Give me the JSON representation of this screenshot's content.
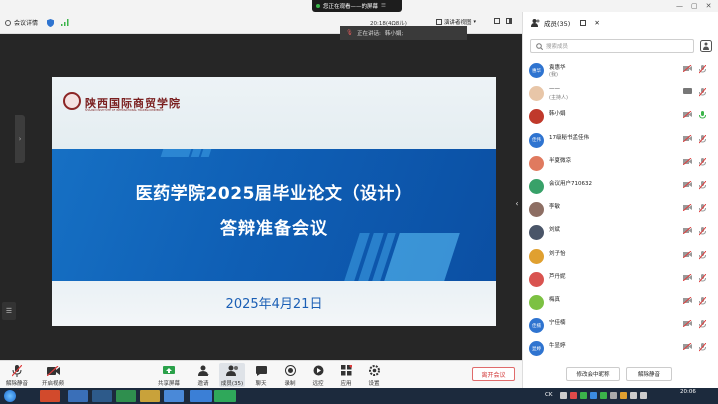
{
  "titlebar": {
    "share_banner": "您正在观看——的屏幕",
    "panel_title": "成员(35)"
  },
  "infobar": {
    "meeting_detail": "会议详情",
    "clock_text": "20:18(4Ω8ル)",
    "view_text": "演讲者视图"
  },
  "speaking": {
    "label": "正在讲话:",
    "name": "韩小娟;"
  },
  "slide": {
    "school_name": "陕西国际商贸学院",
    "school_en": "SHAANXI INSTITUTE OF INTERNATIONAL TRADE&COMMERCE",
    "title_line1": "医药学院2025届毕业论文（设计）",
    "title_line2": "答辩准备会议",
    "date": "2025年4月21日"
  },
  "toolbar": {
    "items": [
      {
        "label": "解除静音",
        "icon": "mic-muted-icon"
      },
      {
        "label": "开启视频",
        "icon": "camera-off-icon"
      },
      {
        "label": "共享屏幕",
        "icon": "share-screen-icon"
      },
      {
        "label": "邀请",
        "icon": "invite-icon"
      },
      {
        "label": "成员(35)",
        "icon": "members-icon"
      },
      {
        "label": "聊天",
        "icon": "chat-icon"
      },
      {
        "label": "录制",
        "icon": "record-icon"
      },
      {
        "label": "远控",
        "icon": "remote-control-icon"
      },
      {
        "label": "应用",
        "icon": "apps-icon"
      },
      {
        "label": "设置",
        "icon": "settings-icon"
      }
    ],
    "leave_label": "离开会议"
  },
  "panel": {
    "search_placeholder": "搜索成员",
    "members": [
      {
        "avatar_text": "惠华",
        "name": "袁惠华",
        "sub": "(我)",
        "color": "#2f74d0"
      },
      {
        "avatar_text": "",
        "name": "——",
        "sub": "(主持人)",
        "color": "#e8c6a8"
      },
      {
        "avatar_text": "",
        "name": "韩小娟",
        "sub": "",
        "color": "#c0392b"
      },
      {
        "avatar_text": "佳伟",
        "name": "17级秘书孟佳伟",
        "sub": "",
        "color": "#2f74d0"
      },
      {
        "avatar_text": "",
        "name": "半夏微凉",
        "sub": "",
        "color": "#e07a5f"
      },
      {
        "avatar_text": "",
        "name": "会议用户710632",
        "sub": "",
        "color": "#38a169"
      },
      {
        "avatar_text": "",
        "name": "李敏",
        "sub": "",
        "color": "#8d6e63"
      },
      {
        "avatar_text": "",
        "name": "刘斌",
        "sub": "",
        "color": "#4a5568"
      },
      {
        "avatar_text": "",
        "name": "刘子怡",
        "sub": "",
        "color": "#e0a030"
      },
      {
        "avatar_text": "",
        "name": "芦丹妮",
        "sub": "",
        "color": "#d9534f"
      },
      {
        "avatar_text": "",
        "name": "梅真",
        "sub": "",
        "color": "#7cc142"
      },
      {
        "avatar_text": "佳楠",
        "name": "宁佳楠",
        "sub": "",
        "color": "#2f74d0"
      },
      {
        "avatar_text": "显婷",
        "name": "牛显婷",
        "sub": "",
        "color": "#2f74d0"
      }
    ],
    "btn_rename": "修改会中昵称",
    "btn_unmute": "解除静音"
  },
  "taskbar": {
    "clock": "20:06",
    "lang": "CK"
  }
}
